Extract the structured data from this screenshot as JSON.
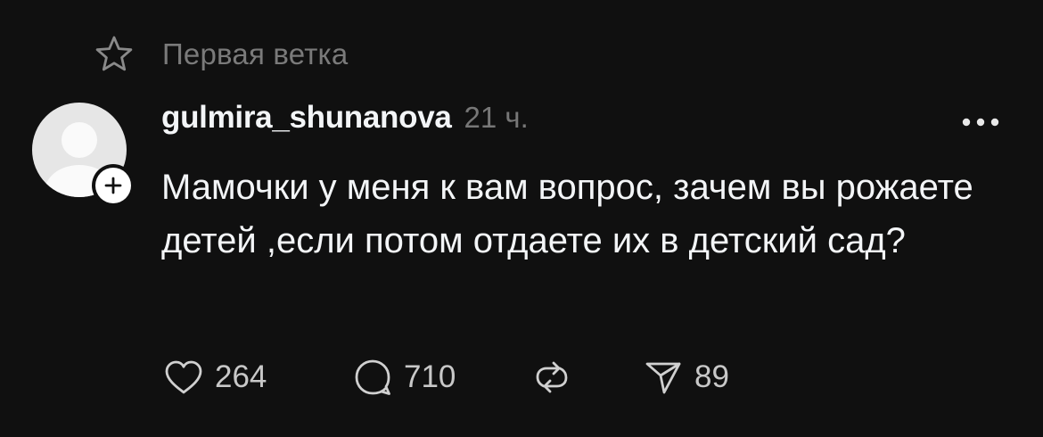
{
  "thread": {
    "label": "Первая ветка",
    "icon": "star-icon"
  },
  "post": {
    "username": "gulmira_shunanova",
    "timestamp": "21 ч.",
    "text": "Мамочки у меня к вам вопрос, зачем вы рожаете детей ,если потом отдаете их в детский сад?",
    "avatar": "default-avatar"
  },
  "actions": {
    "likes": "264",
    "replies": "710",
    "shares": "89"
  },
  "icons": {
    "like": "heart-icon",
    "reply": "comment-icon",
    "repost": "repost-icon",
    "share": "send-icon",
    "more": "more-icon",
    "follow": "plus-icon"
  },
  "colors": {
    "background": "#101010",
    "primary_text": "#f3f5f7",
    "secondary_text": "#777777"
  }
}
